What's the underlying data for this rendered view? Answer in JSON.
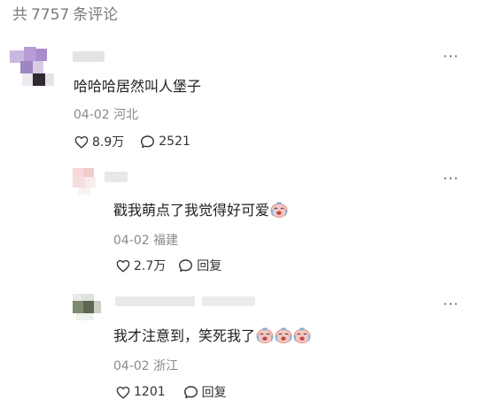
{
  "header": {
    "prefix": "共",
    "count": "7757",
    "suffix": "条评论"
  },
  "icons": {
    "more": "more-dots-icon",
    "like": "heart-icon",
    "reply": "comment-bubble-icon",
    "emoji": "crying-laughing-emoji-icon"
  },
  "colors": {
    "text": "#1f1f1f",
    "meta": "#8a8a8a",
    "header": "#7a7a7a"
  },
  "comments": [
    {
      "more": "···",
      "content": "哈哈哈居然叫人堡子",
      "date": "04-02",
      "location": "河北",
      "likes": "8.9万",
      "replies": "2521"
    },
    {
      "more": "···",
      "content": "戳我萌点了我觉得好可爱",
      "date": "04-02",
      "location": "福建",
      "likes": "2.7万",
      "reply_label": "回复"
    },
    {
      "more": "···",
      "content": "我才注意到，笑死我了",
      "date": "04-02",
      "location": "浙江",
      "likes": "1201",
      "reply_label": "回复"
    }
  ]
}
